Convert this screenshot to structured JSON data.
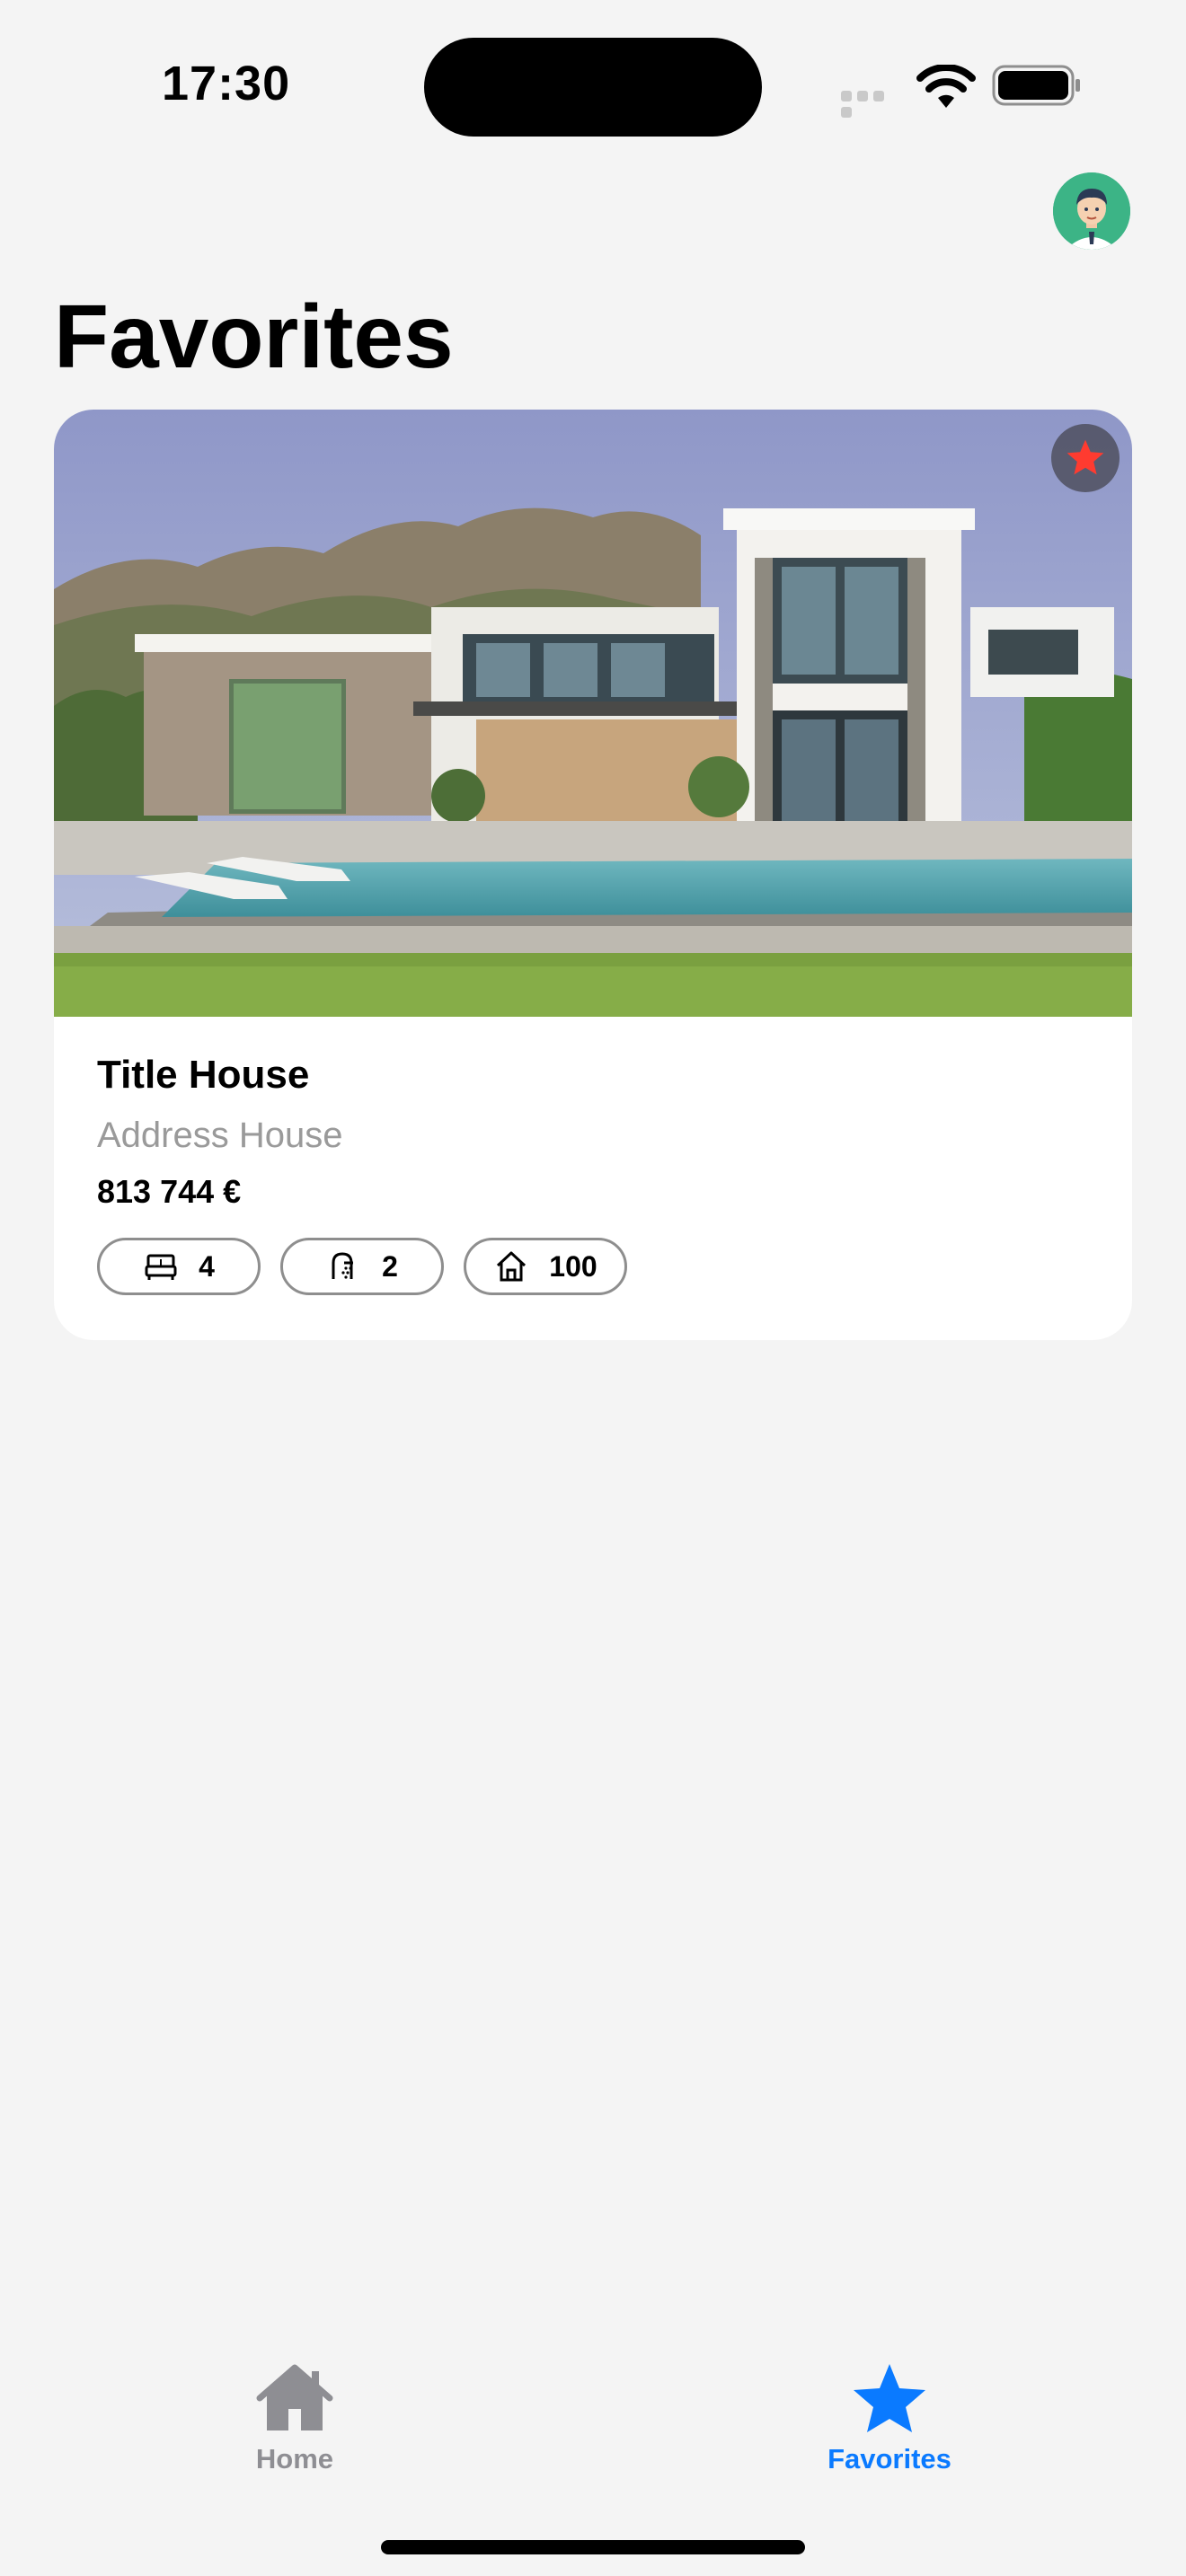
{
  "status_bar": {
    "time": "17:30"
  },
  "header": {
    "title": "Favorites"
  },
  "listing": {
    "title": "Title House",
    "address": "Address House",
    "price": "813 744 €",
    "bedrooms": "4",
    "bathrooms": "2",
    "area": "100",
    "favorited": true,
    "icons": [
      "bed-icon",
      "shower-icon",
      "house-icon",
      "star-icon"
    ]
  },
  "tab_bar": {
    "home_label": "Home",
    "favorites_label": "Favorites",
    "active_tab": "Favorites"
  },
  "colors": {
    "accent": "#0a7aff",
    "favorite_star": "#ff3b30",
    "inactive_tab": "#8e8e93",
    "background": "#f4f4f4"
  }
}
